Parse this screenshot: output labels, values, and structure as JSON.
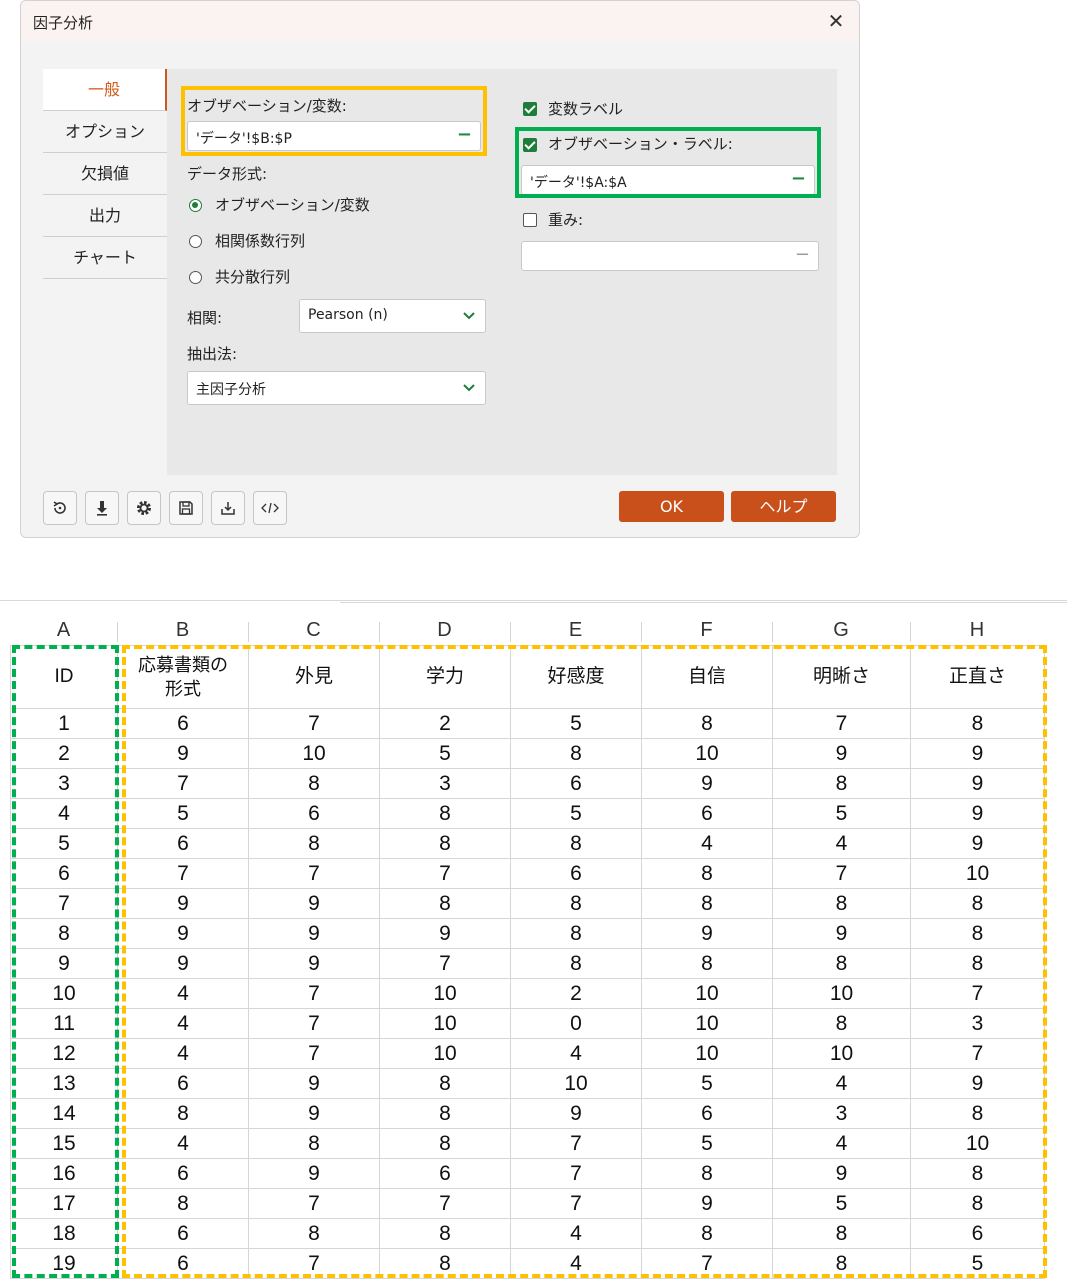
{
  "dialog": {
    "title": "因子分析",
    "close_glyph": "✕",
    "tabs": [
      "一般",
      "オプション",
      "欠損値",
      "出力",
      "チャート"
    ],
    "obs_var_label": "オブザベーション/変数:",
    "obs_var_range": "'データ'!$B:$P",
    "data_format_label": "データ形式:",
    "data_format_options": [
      "オブザベーション/変数",
      "相関係数行列",
      "共分散行列"
    ],
    "data_format_selected": 0,
    "correlation_label": "相関:",
    "correlation_value": "Pearson (n)",
    "extraction_label": "抽出法:",
    "extraction_value": "主因子分析",
    "var_labels_label": "変数ラベル",
    "var_labels_checked": true,
    "obs_labels_label": "オブザベーション・ラベル:",
    "obs_labels_checked": true,
    "obs_labels_range": "'データ'!$A:$A",
    "weights_label": "重み:",
    "weights_checked": false,
    "weights_range": "",
    "ok_label": "OK",
    "help_label": "ヘルプ",
    "toolbar_icons": [
      "reset-icon",
      "download-icon",
      "gear-icon",
      "save-icon",
      "load-icon",
      "code-icon"
    ],
    "colors": {
      "accent": "#c9501a",
      "check_green": "#1e7d3a",
      "highlight_orange": "#ffc000",
      "highlight_green": "#00b050"
    }
  },
  "sheet": {
    "columns": [
      "A",
      "B",
      "C",
      "D",
      "E",
      "F",
      "G",
      "H"
    ],
    "headers": [
      "ID",
      "応募書類の形式",
      "外見",
      "学力",
      "好感度",
      "自信",
      "明晰さ",
      "正直さ"
    ],
    "rows": [
      [
        "1",
        "6",
        "7",
        "2",
        "5",
        "8",
        "7",
        "8"
      ],
      [
        "2",
        "9",
        "10",
        "5",
        "8",
        "10",
        "9",
        "9"
      ],
      [
        "3",
        "7",
        "8",
        "3",
        "6",
        "9",
        "8",
        "9"
      ],
      [
        "4",
        "5",
        "6",
        "8",
        "5",
        "6",
        "5",
        "9"
      ],
      [
        "5",
        "6",
        "8",
        "8",
        "8",
        "4",
        "4",
        "9"
      ],
      [
        "6",
        "7",
        "7",
        "7",
        "6",
        "8",
        "7",
        "10"
      ],
      [
        "7",
        "9",
        "9",
        "8",
        "8",
        "8",
        "8",
        "8"
      ],
      [
        "8",
        "9",
        "9",
        "9",
        "8",
        "9",
        "9",
        "8"
      ],
      [
        "9",
        "9",
        "9",
        "7",
        "8",
        "8",
        "8",
        "8"
      ],
      [
        "10",
        "4",
        "7",
        "10",
        "2",
        "10",
        "10",
        "7"
      ],
      [
        "11",
        "4",
        "7",
        "10",
        "0",
        "10",
        "8",
        "3"
      ],
      [
        "12",
        "4",
        "7",
        "10",
        "4",
        "10",
        "10",
        "7"
      ],
      [
        "13",
        "6",
        "9",
        "8",
        "10",
        "5",
        "4",
        "9"
      ],
      [
        "14",
        "8",
        "9",
        "8",
        "9",
        "6",
        "3",
        "8"
      ],
      [
        "15",
        "4",
        "8",
        "8",
        "7",
        "5",
        "4",
        "10"
      ],
      [
        "16",
        "6",
        "9",
        "6",
        "7",
        "8",
        "9",
        "8"
      ],
      [
        "17",
        "8",
        "7",
        "7",
        "7",
        "9",
        "5",
        "8"
      ],
      [
        "18",
        "6",
        "8",
        "8",
        "4",
        "8",
        "8",
        "6"
      ],
      [
        "19",
        "6",
        "7",
        "8",
        "4",
        "7",
        "8",
        "5"
      ]
    ]
  }
}
